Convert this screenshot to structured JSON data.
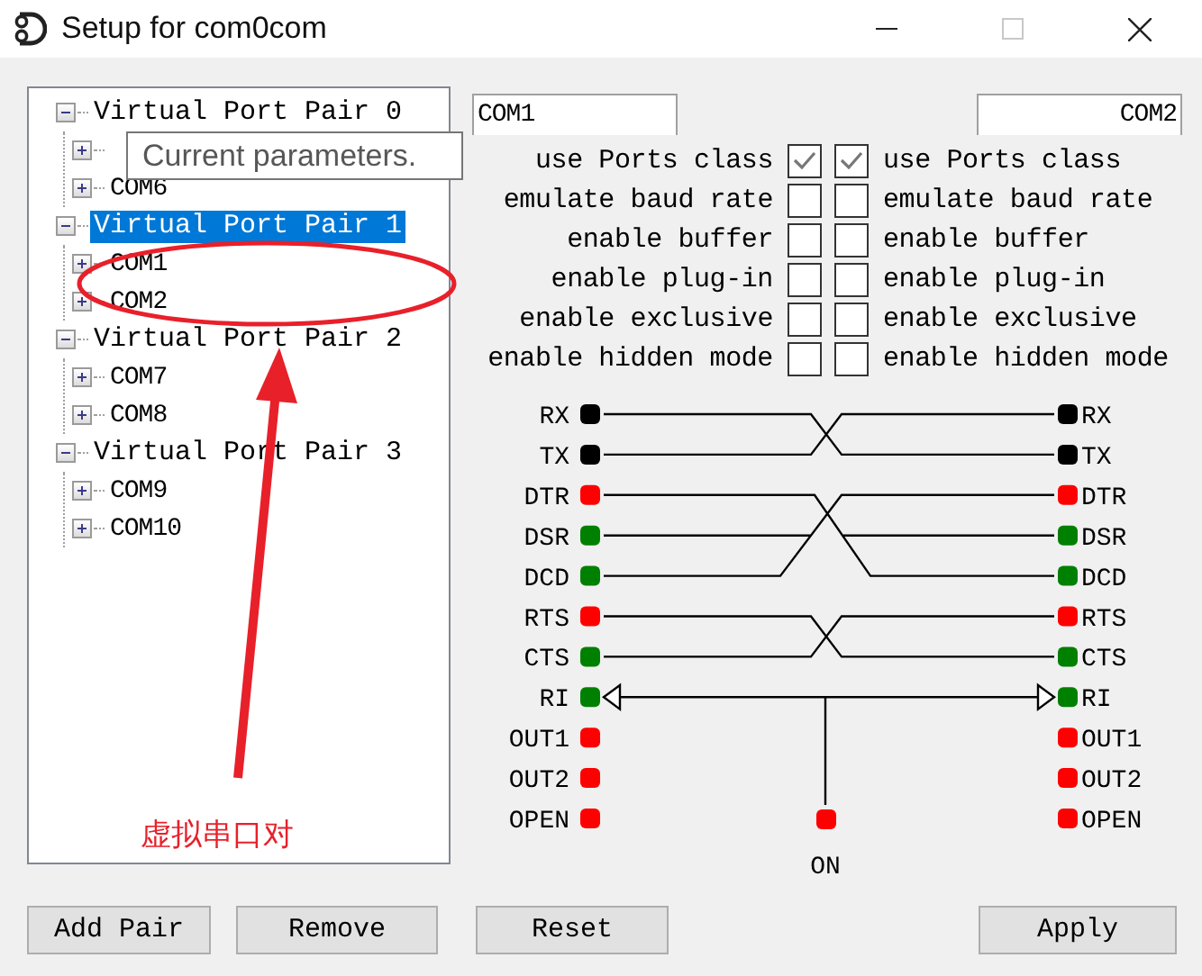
{
  "window": {
    "title": "Setup for com0com"
  },
  "tree": [
    {
      "label": "Virtual Port Pair 0",
      "expanded": true,
      "selected": false,
      "children": [
        {
          "expanded": false
        },
        {
          "label": "COM6",
          "expanded": false
        }
      ]
    },
    {
      "label": "Virtual Port Pair 1",
      "expanded": true,
      "selected": true,
      "children": [
        {
          "label": "COM1",
          "expanded": false
        },
        {
          "label": "COM2",
          "expanded": false
        }
      ]
    },
    {
      "label": "Virtual Port Pair 2",
      "expanded": true,
      "selected": false,
      "children": [
        {
          "label": "COM7",
          "expanded": false
        },
        {
          "label": "COM8",
          "expanded": false
        }
      ]
    },
    {
      "label": "Virtual Port Pair 3",
      "expanded": true,
      "selected": false,
      "children": [
        {
          "label": "COM9",
          "expanded": false
        },
        {
          "label": "COM10",
          "expanded": false
        }
      ]
    }
  ],
  "tooltip": {
    "text": "Current parameters."
  },
  "ports": {
    "left": "COM1",
    "right": "COM2"
  },
  "options": [
    {
      "left_label": "use Ports class",
      "left_checked": true,
      "right_checked": true,
      "right_label": "use Ports class"
    },
    {
      "left_label": "emulate baud rate",
      "left_checked": false,
      "right_checked": false,
      "right_label": "emulate baud rate"
    },
    {
      "left_label": "enable buffer",
      "left_checked": false,
      "right_checked": false,
      "right_label": "enable buffer"
    },
    {
      "left_label": "enable plug-in",
      "left_checked": false,
      "right_checked": false,
      "right_label": "enable plug-in"
    },
    {
      "left_label": "enable exclusive",
      "left_checked": false,
      "right_checked": false,
      "right_label": "enable exclusive"
    },
    {
      "left_label": "enable hidden mode",
      "left_checked": false,
      "right_checked": false,
      "right_label": "enable hidden mode"
    }
  ],
  "signals": [
    {
      "left": {
        "label": "RX",
        "color": "#000000"
      },
      "right": {
        "label": "RX",
        "color": "#000000"
      }
    },
    {
      "left": {
        "label": "TX",
        "color": "#000000"
      },
      "right": {
        "label": "TX",
        "color": "#000000"
      }
    },
    {
      "left": {
        "label": "DTR",
        "color": "#ff0000"
      },
      "right": {
        "label": "DTR",
        "color": "#ff0000"
      }
    },
    {
      "left": {
        "label": "DSR",
        "color": "#008000"
      },
      "right": {
        "label": "DSR",
        "color": "#008000"
      }
    },
    {
      "left": {
        "label": "DCD",
        "color": "#008000"
      },
      "right": {
        "label": "DCD",
        "color": "#008000"
      }
    },
    {
      "left": {
        "label": "RTS",
        "color": "#ff0000"
      },
      "right": {
        "label": "RTS",
        "color": "#ff0000"
      }
    },
    {
      "left": {
        "label": "CTS",
        "color": "#008000"
      },
      "right": {
        "label": "CTS",
        "color": "#008000"
      }
    },
    {
      "left": {
        "label": "RI",
        "color": "#008000"
      },
      "right": {
        "label": "RI",
        "color": "#008000"
      }
    },
    {
      "left": {
        "label": "OUT1",
        "color": "#ff0000"
      },
      "right": {
        "label": "OUT1",
        "color": "#ff0000"
      }
    },
    {
      "left": {
        "label": "OUT2",
        "color": "#ff0000"
      },
      "right": {
        "label": "OUT2",
        "color": "#ff0000"
      }
    },
    {
      "left": {
        "label": "OPEN",
        "color": "#ff0000"
      },
      "right": {
        "label": "OPEN",
        "color": "#ff0000"
      }
    }
  ],
  "on_switch": {
    "label": "ON",
    "color": "#ff0000"
  },
  "buttons": [
    {
      "label": "Add Pair"
    },
    {
      "label": "Remove"
    },
    {
      "label": "Reset"
    },
    {
      "label": "Apply"
    }
  ],
  "annotation": {
    "text": "虚拟串口对"
  }
}
